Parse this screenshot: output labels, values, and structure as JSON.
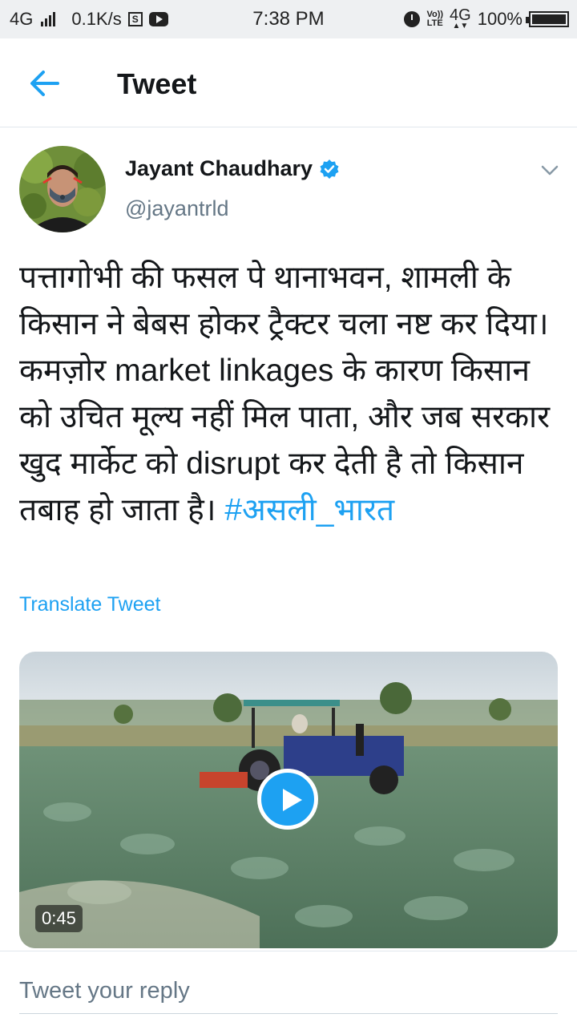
{
  "status_bar": {
    "network_type": "4G",
    "speed": "0.1K/s",
    "time": "7:38 PM",
    "volte_label": "Vo)) LTE",
    "network_right": "4G",
    "battery": "100%",
    "battery_level": 1.0,
    "icons": [
      "signal-icon",
      "s-app-icon",
      "youtube-icon",
      "alarm-icon",
      "volte-icon",
      "battery-icon"
    ]
  },
  "header": {
    "back_icon": "arrow-left-icon",
    "title": "Tweet"
  },
  "tweet": {
    "author_name": "Jayant Chaudhary",
    "verified_icon": "verified-badge-icon",
    "handle": "@jayantrld",
    "text": "पत्तागोभी की फसल पे थानाभवन, शामली के किसान ने बेबस होकर ट्रैक्टर चला नष्ट कर दिया। कमज़ोर market linkages के कारण किसान को उचित मूल्य नहीं मिल पाता, और जब सरकार खुद मार्केट को disrupt कर देती है तो किसान तबाह हो जाता है।",
    "hashtag": "#असली_भारत",
    "translate_label": "Translate Tweet",
    "media": {
      "duration": "0:45",
      "play_icon": "play-icon"
    },
    "menu_icon": "chevron-down-icon"
  },
  "reply": {
    "placeholder": "Tweet your reply"
  },
  "colors": {
    "accent": "#1da1f2",
    "text_primary": "#14171a",
    "text_secondary": "#657786"
  }
}
